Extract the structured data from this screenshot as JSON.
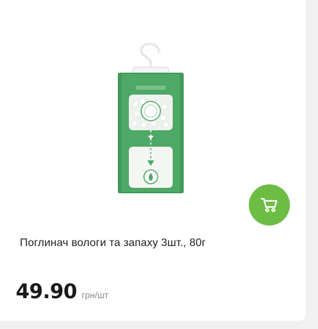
{
  "product": {
    "title": "Поглинач вологи та запаху 3шт., 80г",
    "price": "49.90",
    "price_unit": "грн/шт",
    "image_icon": "moisture-absorber-bag-image"
  },
  "actions": {
    "add_to_cart_icon": "cart-icon"
  },
  "colors": {
    "accent": "#6dbd45",
    "package_green": "#3d9a59",
    "card_bg": "#ffffff",
    "page_bg": "#f1f1f1"
  }
}
